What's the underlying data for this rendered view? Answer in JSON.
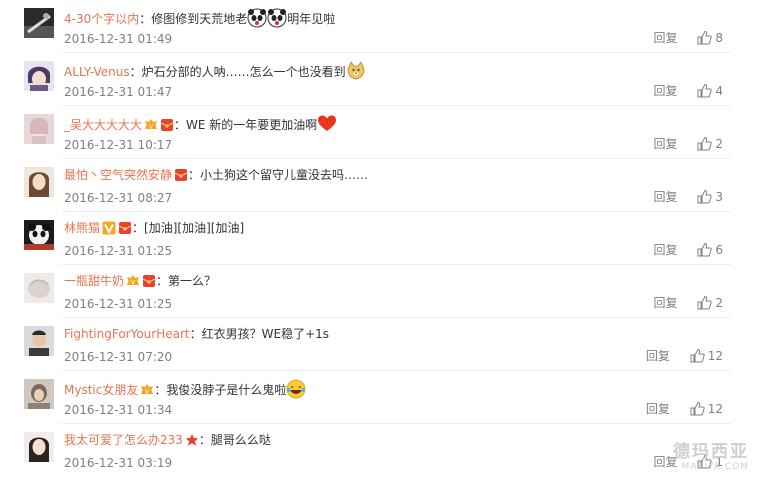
{
  "colors": {
    "username": "#eb7350",
    "meta": "#808080",
    "text": "#333333"
  },
  "comments": [
    {
      "user": "4-30个字以内",
      "colon": "：",
      "text": "修图修到天荒地老",
      "text_after": "明年见啦",
      "time": "2016-12-31 01:49",
      "reply": "回复",
      "likes": "8"
    },
    {
      "user": "ALLY-Venus",
      "colon": "：",
      "text": "炉石分部的人呐……怎么一个也没看到",
      "text_after": "",
      "time": "2016-12-31 01:47",
      "reply": "回复",
      "likes": "4"
    },
    {
      "user": "_吴大大大大大",
      "colon": "：",
      "text": "WE 新的一年要更加油啊",
      "text_after": "",
      "time": "2016-12-31 10:17",
      "reply": "回复",
      "likes": "2"
    },
    {
      "user": "最怕丶空气突然安静",
      "colon": "：",
      "text": "小土狗这个留守儿童没去吗……",
      "text_after": "",
      "time": "2016-12-31 08:27",
      "reply": "回复",
      "likes": "3"
    },
    {
      "user": "林熊猫",
      "colon": "：",
      "text": "[加油][加油][加油]",
      "text_after": "",
      "time": "2016-12-31 01:25",
      "reply": "回复",
      "likes": "6"
    },
    {
      "user": "一瓶甜牛奶",
      "colon": "：",
      "text": "第一么？",
      "text_after": "",
      "time": "2016-12-31 01:25",
      "reply": "回复",
      "likes": "2"
    },
    {
      "user": "FightingForYourHeart",
      "colon": "：",
      "text": "红衣男孩？WE稳了+1s",
      "text_after": "",
      "time": "2016-12-31 07:20",
      "reply": "回复",
      "likes": "12"
    },
    {
      "user": "Mystic女朋友",
      "colon": "：",
      "text": "我俊没脖子是什么鬼啦",
      "text_after": "",
      "time": "2016-12-31 01:34",
      "reply": "回复",
      "likes": "12"
    },
    {
      "user": "我太可爱了怎么办233",
      "colon": "：",
      "text": "腿哥么么哒",
      "text_after": "",
      "time": "2016-12-31 03:19",
      "reply": "回复",
      "likes": "1"
    }
  ],
  "watermark": {
    "line1": "德玛西亚",
    "line2": "MAXIYA.COM"
  }
}
